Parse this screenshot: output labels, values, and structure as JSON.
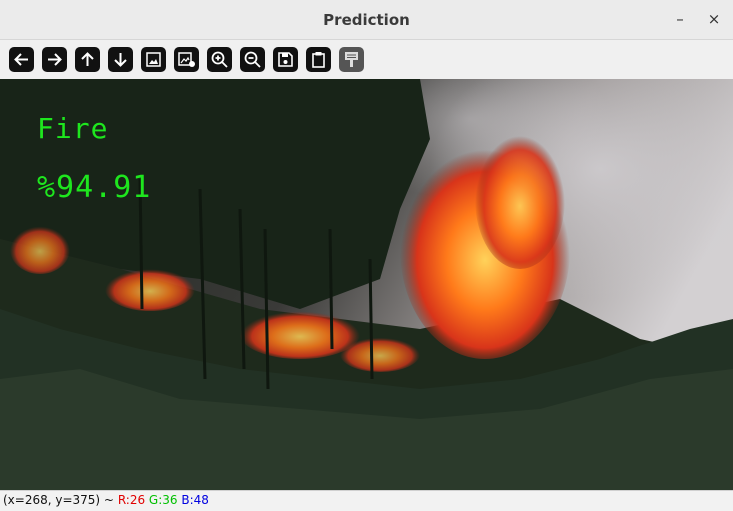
{
  "window": {
    "title": "Prediction",
    "minimize_glyph": "–",
    "close_glyph": "×"
  },
  "toolbar": {
    "buttons": [
      {
        "icon": "arrow-left-icon",
        "enabled": true
      },
      {
        "icon": "arrow-right-icon",
        "enabled": true
      },
      {
        "icon": "arrow-up-icon",
        "enabled": true
      },
      {
        "icon": "arrow-down-icon",
        "enabled": true
      },
      {
        "icon": "image-icon",
        "enabled": true
      },
      {
        "icon": "image-settings-icon",
        "enabled": true
      },
      {
        "icon": "zoom-in-icon",
        "enabled": true
      },
      {
        "icon": "zoom-out-icon",
        "enabled": true
      },
      {
        "icon": "save-icon",
        "enabled": true
      },
      {
        "icon": "clipboard-icon",
        "enabled": true
      },
      {
        "icon": "properties-icon",
        "enabled": false
      }
    ]
  },
  "overlay": {
    "class_label": "Fire",
    "confidence": "%94.91",
    "text_color": "#1ee61e"
  },
  "status": {
    "coords": "(x=268, y=375) ~",
    "r": "R:26",
    "g": "G:36",
    "b": "B:48"
  }
}
